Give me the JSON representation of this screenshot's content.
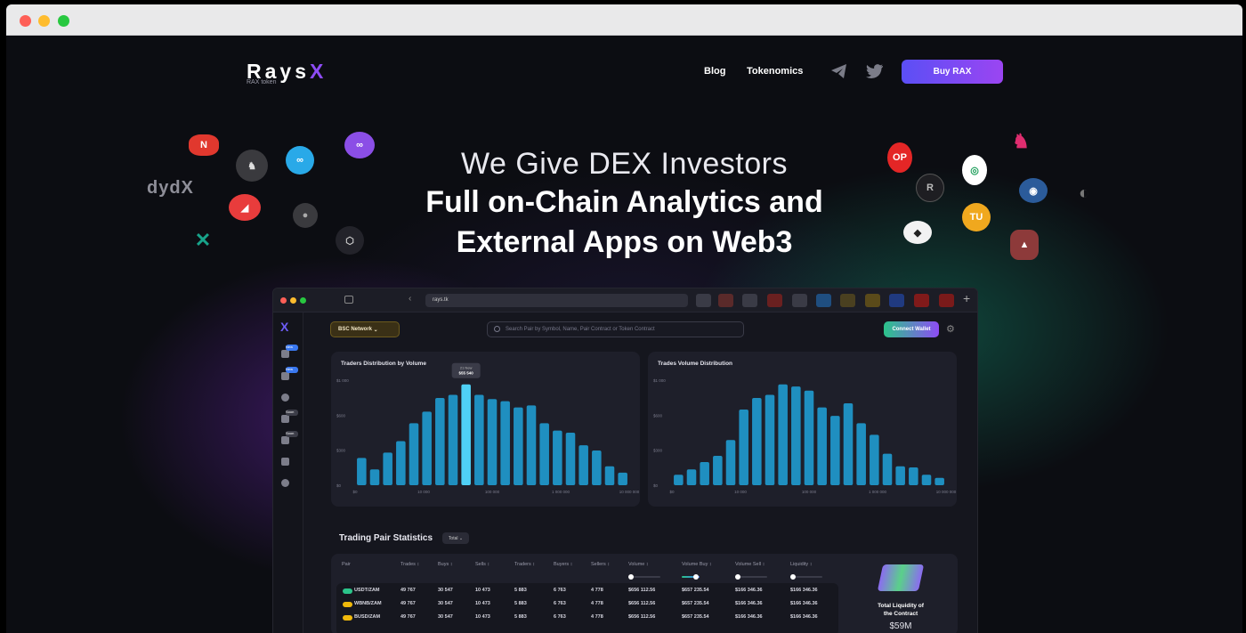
{
  "window": {
    "controls": [
      "close",
      "minimize",
      "maximize"
    ]
  },
  "nav": {
    "logo_text": "Rays",
    "logo_x": "X",
    "logo_sub": "RAX token",
    "links": [
      "Blog",
      "Tokenomics"
    ],
    "icons": [
      "telegram-icon",
      "twitter-icon"
    ],
    "buy_label": "Buy RAX"
  },
  "hero": {
    "line1": "We Give DEX Investors",
    "line2": "Full on-Chain Analytics and",
    "line3": "External Apps on Web3"
  },
  "floating": {
    "dydx": "dydX"
  },
  "app": {
    "url": "rays.tk",
    "network": "BSC Network",
    "search_placeholder": "Search Pair by Symbol, Name, Pair Contract or Token Contract",
    "connect_label": "Connect Wallet",
    "sidebar_badges": [
      "New",
      "New",
      "Soon",
      "Soon"
    ],
    "table": {
      "title": "Trading Pair Statistics",
      "filter": "Total",
      "headers": [
        "Pair",
        "Trades",
        "Buys",
        "Sells",
        "Traders",
        "Buyers",
        "Sellers",
        "Volume",
        "Volume Buy",
        "Volume Sell",
        "Liquidity"
      ],
      "rows": [
        [
          "USDT/ZAM",
          "49 767",
          "30 547",
          "10 473",
          "5 883",
          "6 763",
          "4 778",
          "$656 112.56",
          "$657 235.54",
          "$166 346.36",
          "$166 346.36"
        ],
        [
          "WBNB/ZAM",
          "49 767",
          "30 547",
          "10 473",
          "5 883",
          "6 763",
          "4 778",
          "$656 112.56",
          "$657 235.54",
          "$166 346.36",
          "$166 346.36"
        ],
        [
          "BUSD/ZAM",
          "49 767",
          "30 547",
          "10 473",
          "5 883",
          "6 763",
          "4 778",
          "$656 112.56",
          "$657 235.54",
          "$166 346.36",
          "$166 346.36"
        ]
      ],
      "liquidity_label_1": "Total Liquidity of",
      "liquidity_label_2": "the Contract",
      "liquidity_value": "$59M"
    }
  },
  "chart_data": [
    {
      "type": "bar",
      "title": "Traders Distribution by Volume",
      "ytick_labels": [
        "$0",
        "$300",
        "$600",
        "$1 000"
      ],
      "xtick_labels": [
        "$0",
        "10 000",
        "100 000",
        "1 000 000",
        "10 000 000"
      ],
      "tooltip": {
        "line1": "21 New",
        "line2": "$55 540"
      },
      "highlight_index": 8,
      "values": [
        260,
        150,
        310,
        420,
        590,
        700,
        830,
        860,
        960,
        860,
        820,
        800,
        740,
        760,
        590,
        520,
        500,
        380,
        330,
        180,
        120
      ]
    },
    {
      "type": "bar",
      "title": "Trades Volume Distribution",
      "ytick_labels": [
        "$0",
        "$300",
        "$600",
        "$1 000"
      ],
      "xtick_labels": [
        "$0",
        "10 000",
        "100 000",
        "1 000 000",
        "10 000 000"
      ],
      "values": [
        100,
        150,
        220,
        280,
        430,
        720,
        830,
        860,
        960,
        940,
        900,
        740,
        660,
        780,
        590,
        480,
        300,
        180,
        170,
        100,
        70
      ]
    }
  ]
}
